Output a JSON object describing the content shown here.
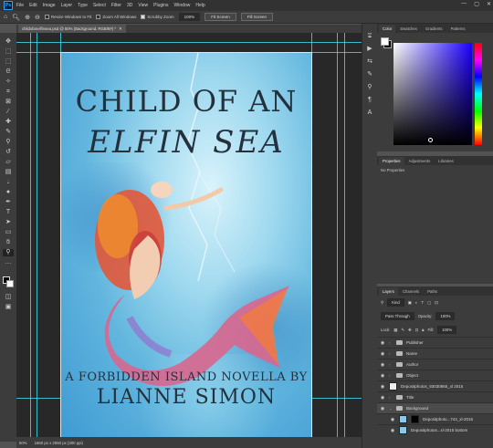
{
  "menu": [
    "File",
    "Edit",
    "Image",
    "Layer",
    "Type",
    "Select",
    "Filter",
    "3D",
    "View",
    "Plugins",
    "Window",
    "Help"
  ],
  "options": {
    "resize_windows": "Resize Windows to Fit",
    "zoom_all": "Zoom All Windows",
    "scrubby_zoom": "Scrubby Zoom",
    "zoom_value": "100%",
    "fit_screen": "Fit Screen",
    "fill_screen": "Fill Screen"
  },
  "document": {
    "tab_title": "childofanelfinsea.psd @ 50% (Background, RGB/8#) *"
  },
  "cover": {
    "title_line1": "CHILD OF AN",
    "title_line2": "ELFIN SEA",
    "subtitle": "A FORBIDDEN ISLAND NOVELLA BY",
    "author": "LIANNE SIMON"
  },
  "status": {
    "zoom": "50%",
    "info": "1650 px x 2550 px (300 ppi)"
  },
  "color_panel": {
    "tabs": [
      "Color",
      "Swatches",
      "Gradients",
      "Patterns"
    ]
  },
  "properties_panel": {
    "tabs": [
      "Properties",
      "Adjustments",
      "Libraries"
    ],
    "empty_text": "No Properties"
  },
  "layers_panel": {
    "tabs": [
      "Layers",
      "Channels",
      "Paths"
    ],
    "kind": "Kind",
    "blend_mode": "Pass Through",
    "opacity_label": "Opacity:",
    "opacity": "100%",
    "lock_label": "Lock:",
    "fill_label": "Fill:",
    "fill": "100%",
    "layers": [
      {
        "name": "Publisher",
        "type": "folder"
      },
      {
        "name": "Name",
        "type": "folder"
      },
      {
        "name": "Author",
        "type": "folder"
      },
      {
        "name": "Object",
        "type": "folder"
      },
      {
        "name": "Depositphotos_93030865_xl 2015",
        "type": "image"
      },
      {
        "name": "Title",
        "type": "folder"
      },
      {
        "name": "Background",
        "type": "folder"
      },
      {
        "name": "Depositphoto...743_xl-2015",
        "type": "masked"
      },
      {
        "name": "Depositphotos...xl-2015 bottom",
        "type": "image"
      }
    ]
  }
}
